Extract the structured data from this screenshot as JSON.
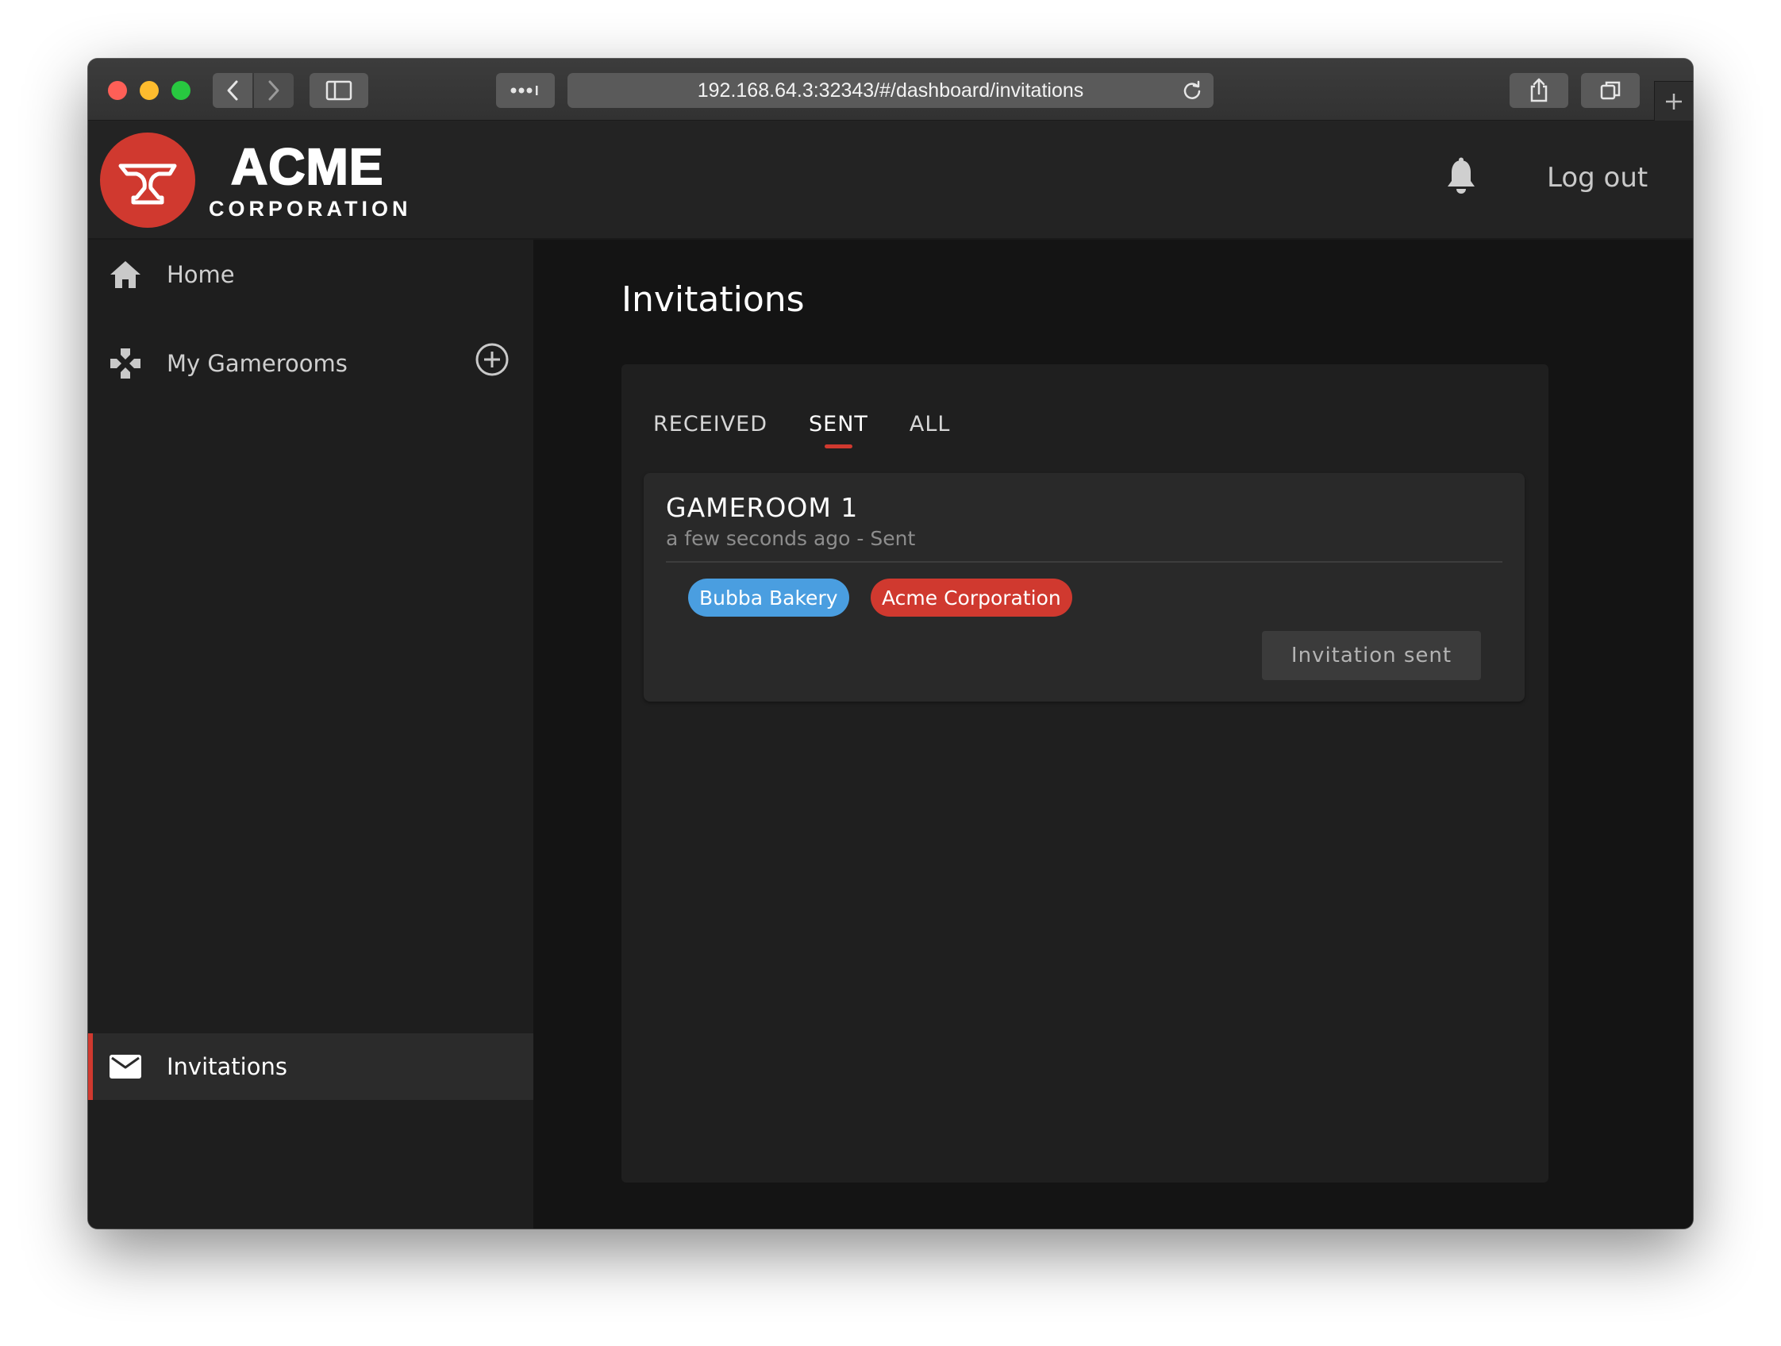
{
  "browser": {
    "url": "192.168.64.3:32343/#/dashboard/invitations"
  },
  "header": {
    "brand_main": "ACME",
    "brand_sub": "CORPORATION",
    "logout_label": "Log out",
    "brand_color": "#d0392f"
  },
  "sidebar": {
    "items": [
      {
        "label": "Home",
        "icon": "home-icon"
      },
      {
        "label": "My Gamerooms",
        "icon": "gamepad-icon"
      }
    ],
    "active_item": {
      "label": "Invitations",
      "icon": "envelope-icon"
    }
  },
  "main": {
    "title": "Invitations",
    "tabs": [
      {
        "label": "RECEIVED",
        "active": false
      },
      {
        "label": "SENT",
        "active": true
      },
      {
        "label": "ALL",
        "active": false
      }
    ],
    "invitations": [
      {
        "name": "GAMEROOM 1",
        "meta": "a few seconds ago - Sent",
        "members": [
          {
            "label": "Bubba Bakery",
            "color": "#4a9ee0"
          },
          {
            "label": "Acme Corporation",
            "color": "#d0392f"
          }
        ],
        "status_button": "Invitation sent"
      }
    ]
  }
}
